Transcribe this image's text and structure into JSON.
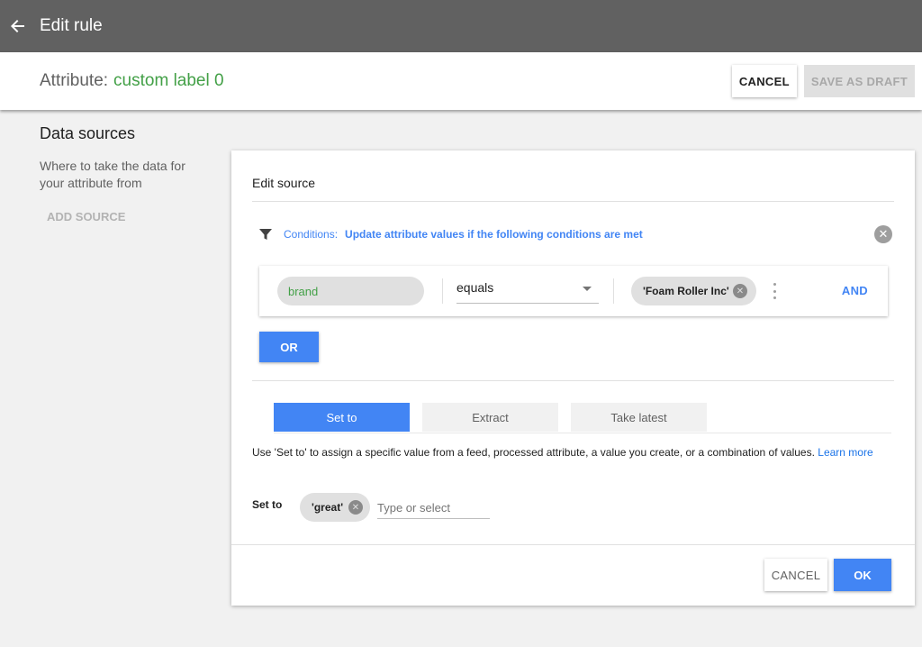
{
  "app_bar": {
    "title": "Edit rule",
    "back_icon": "arrow-left-icon"
  },
  "header": {
    "attribute_label": "Attribute:",
    "attribute_name": "custom label 0",
    "cancel_label": "CANCEL",
    "save_draft_label": "SAVE AS DRAFT"
  },
  "sidebar": {
    "title": "Data sources",
    "description": "Where to take the data for your attribute from",
    "add_source_label": "ADD SOURCE"
  },
  "edit_source": {
    "title": "Edit source",
    "conditions": {
      "label": "Conditions:",
      "text": "Update attribute values if the following conditions are met",
      "icon": "filter-icon",
      "close_icon": "close-circle-icon"
    },
    "condition_row": {
      "field": "brand",
      "operator": "equals",
      "value": "'Foam Roller Inc'",
      "and_label": "AND"
    },
    "or_label": "OR",
    "tabs": [
      {
        "label": "Set to",
        "active": true
      },
      {
        "label": "Extract",
        "active": false
      },
      {
        "label": "Take latest",
        "active": false
      }
    ],
    "help_text": "Use 'Set to' to assign a specific value from a feed, processed attribute, a value you create, or a combination of values.",
    "learn_more_label": "Learn more",
    "set_to": {
      "label": "Set to",
      "value": "'great'",
      "placeholder": "Type or select"
    },
    "cancel_label": "CANCEL",
    "ok_label": "OK"
  },
  "colors": {
    "app_bar": "#616161",
    "primary": "#4285f4",
    "attribute_green": "#43a047",
    "chip": "#e0e0e0"
  }
}
